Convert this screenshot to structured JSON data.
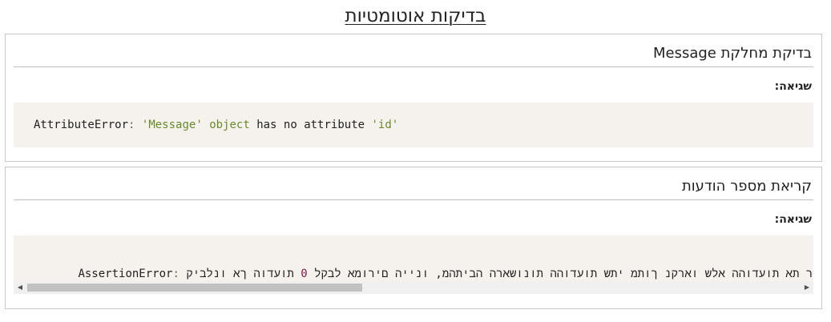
{
  "page": {
    "title": "בדיקות אוטומטיות"
  },
  "tests": [
    {
      "title": "בדיקת מחלקת Message",
      "error_label": "שגיאה:",
      "error": {
        "type": "AttributeError",
        "separator": ":",
        "quote_name": "'Message'",
        "builtin": "object",
        "text": "has no attribute",
        "quote_attr": "'id'"
      }
    },
    {
      "title": "קריאת מספר הודעות",
      "error_label": "שגיאה:",
      "error": {
        "type": "AssertionError",
        "separator": ":",
        "message_before": "קיבלנו אך הודעות",
        "number": "0",
        "message_after": "לקבל אמורים היינו ,מהתיבה הראשונות ההודעות שתי מתוך נקראו שלא ההודעות את רק לקבל שוב ביקשנו ואז נות"
      },
      "scrollbar": {
        "left_arrow": "◀",
        "right_arrow": "▶",
        "thumb_fraction": 0.42
      }
    }
  ]
}
